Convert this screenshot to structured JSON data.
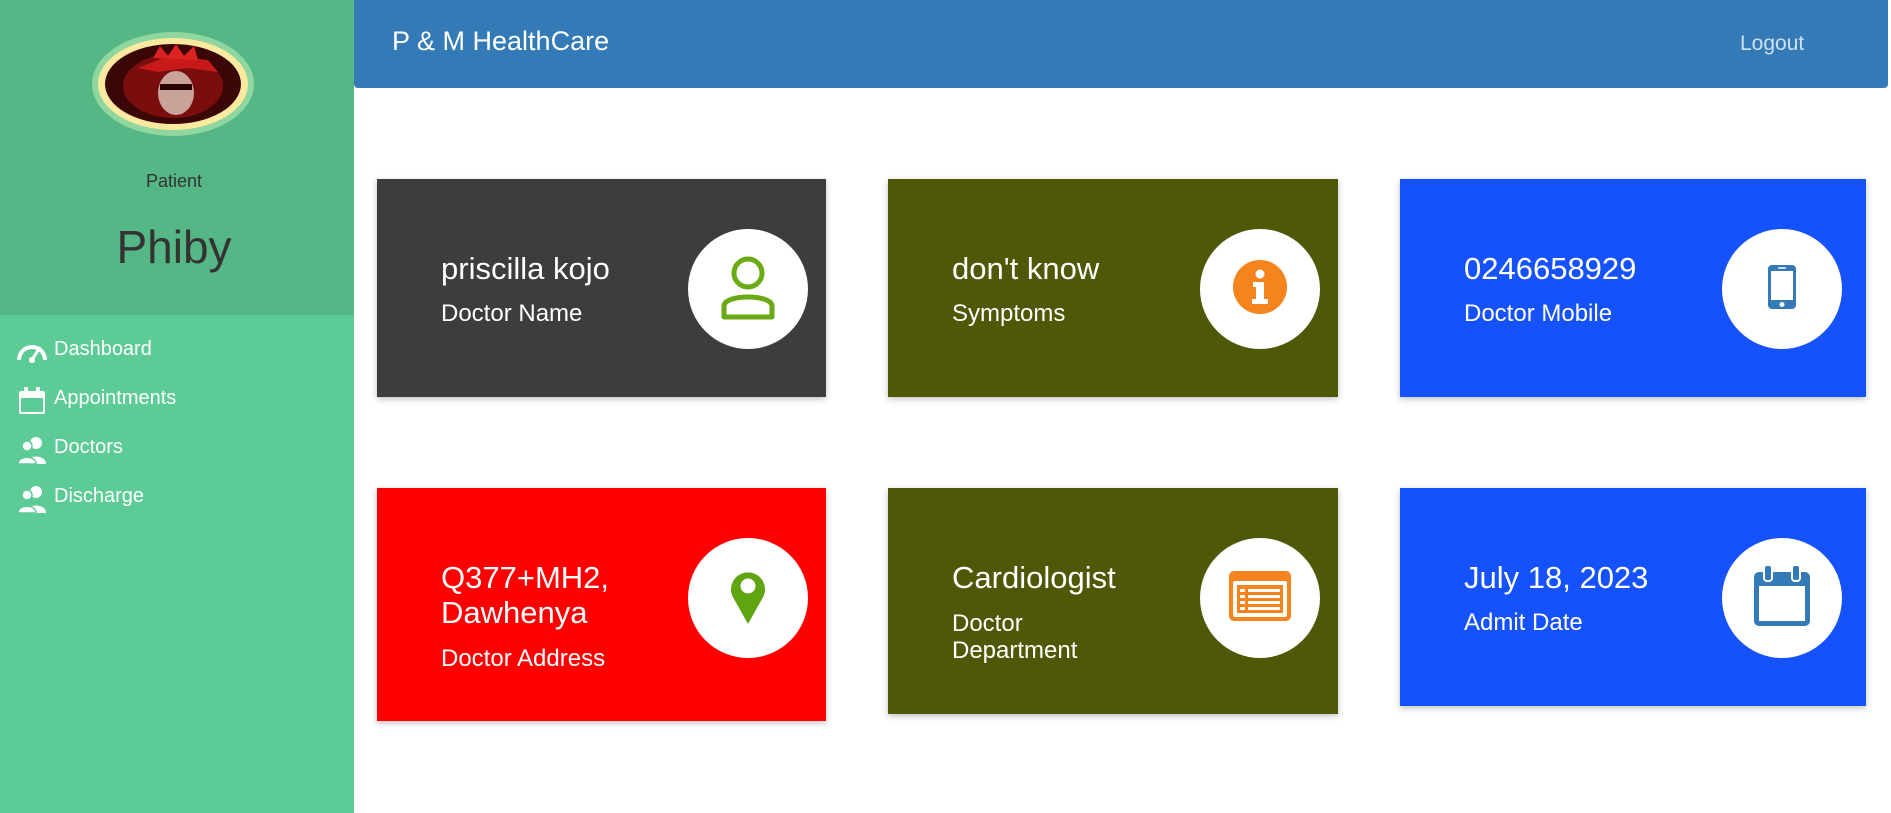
{
  "sidebar": {
    "role": "Patient",
    "username": "Phiby",
    "nav": [
      {
        "label": "Dashboard",
        "icon": "speedometer-icon"
      },
      {
        "label": "Appointments",
        "icon": "calendar-icon"
      },
      {
        "label": "Doctors",
        "icon": "users-icon"
      },
      {
        "label": "Discharge",
        "icon": "users-icon"
      }
    ]
  },
  "header": {
    "brand": "P & M HealthCare",
    "logout": "Logout"
  },
  "cards": [
    {
      "value": "priscilla kojo",
      "label": "Doctor Name",
      "color": "#3d3d3d",
      "icon": "user-icon",
      "icon_color": "#6aaa14"
    },
    {
      "value": "don't know",
      "label": "Symptoms",
      "color": "#4f5806",
      "icon": "info-icon",
      "icon_color": "#f5841f"
    },
    {
      "value": "0246658929",
      "label": "Doctor Mobile",
      "color": "#1552fb",
      "icon": "mobile-phone-icon",
      "icon_color": "#337ab7"
    },
    {
      "value": "Q377+MH2, Dawhenya",
      "label": "Doctor Address",
      "color": "#ff0000",
      "icon": "map-marker-icon",
      "icon_color": "#5fa512"
    },
    {
      "value": "Cardiologist",
      "label": "Doctor Department",
      "color": "#4f5806",
      "icon": "list-card-icon",
      "icon_color": "#f5841f"
    },
    {
      "value": "July 18, 2023",
      "label": "Admit Date",
      "color": "#1552fb",
      "icon": "calendar-icon",
      "icon_color": "#337ab7"
    }
  ]
}
